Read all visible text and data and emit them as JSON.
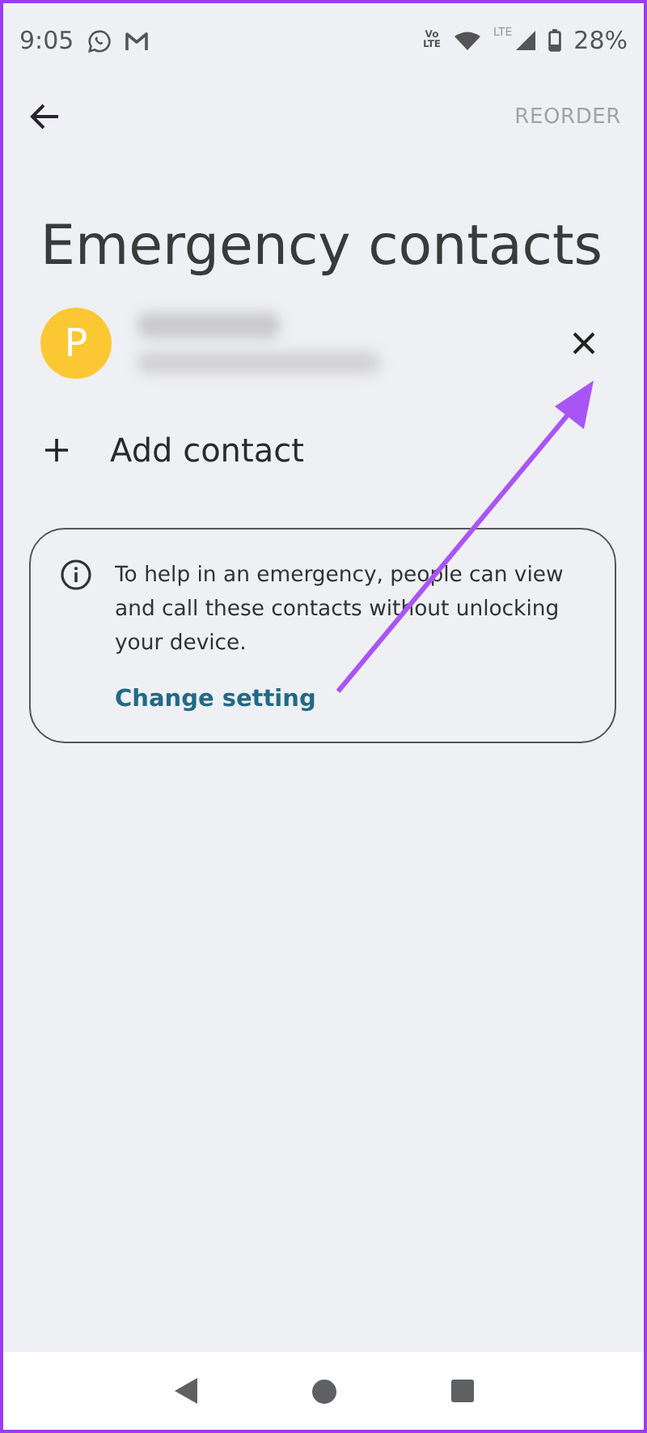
{
  "status_bar": {
    "time": "9:05",
    "volte": "Vo LTE",
    "network": "LTE",
    "battery": "28%"
  },
  "toolbar": {
    "action": "REORDER"
  },
  "title": "Emergency contacts",
  "contacts": [
    {
      "initial": "P",
      "color": "#fbc834"
    }
  ],
  "add_contact": {
    "label": "Add contact"
  },
  "info_card": {
    "text": "To help in an emergency, people can view and call these contacts without unlocking your device.",
    "link": "Change setting"
  }
}
